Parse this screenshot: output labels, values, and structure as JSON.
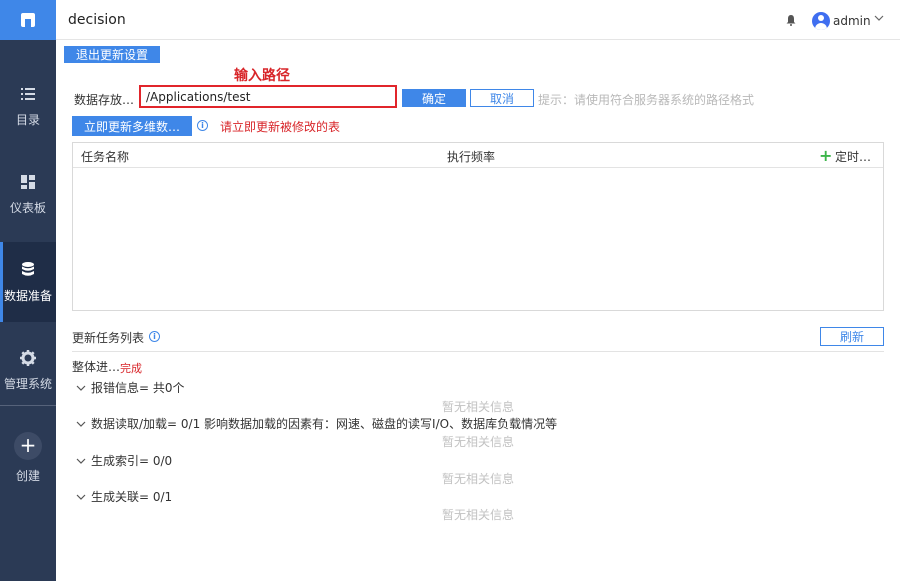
{
  "app": {
    "title": "decision"
  },
  "user": {
    "name": "admin"
  },
  "sidebar": {
    "items": [
      {
        "label": "目录"
      },
      {
        "label": "仪表板"
      },
      {
        "label": "数据准备"
      },
      {
        "label": "管理系统"
      }
    ],
    "create_label": "创建"
  },
  "toolbar": {
    "exit_label": "退出更新设置"
  },
  "annotation": {
    "title": "输入路径",
    "note": "请立即更新被修改的表"
  },
  "path": {
    "label": "数据存放…",
    "value": "/Applications/test",
    "confirm_label": "确定",
    "cancel_label": "取消",
    "hint": "提示：请使用符合服务器系统的路径格式"
  },
  "update_now_label": "立即更新多维数…",
  "task_table": {
    "columns": [
      "任务名称",
      "执行频率",
      "定时…"
    ],
    "add_symbol": "+"
  },
  "task_list": {
    "title": "更新任务列表",
    "refresh_label": "刷新",
    "progress_label": "整体进…",
    "progress_status": "完成",
    "groups": [
      {
        "label": "报错信息= 共0个",
        "empty": "暂无相关信息"
      },
      {
        "label": "数据读取/加载= 0/1 影响数据加载的因素有：网速、磁盘的读写I/O、数据库负载情况等",
        "empty": "暂无相关信息"
      },
      {
        "label": "生成索引= 0/0",
        "empty": "暂无相关信息"
      },
      {
        "label": "生成关联= 0/1",
        "empty": "暂无相关信息"
      }
    ]
  },
  "colors": {
    "accent": "#3f87e8",
    "sidebar": "#2b3a55",
    "highlight": "#e1252b",
    "success": "#3cb54a"
  }
}
